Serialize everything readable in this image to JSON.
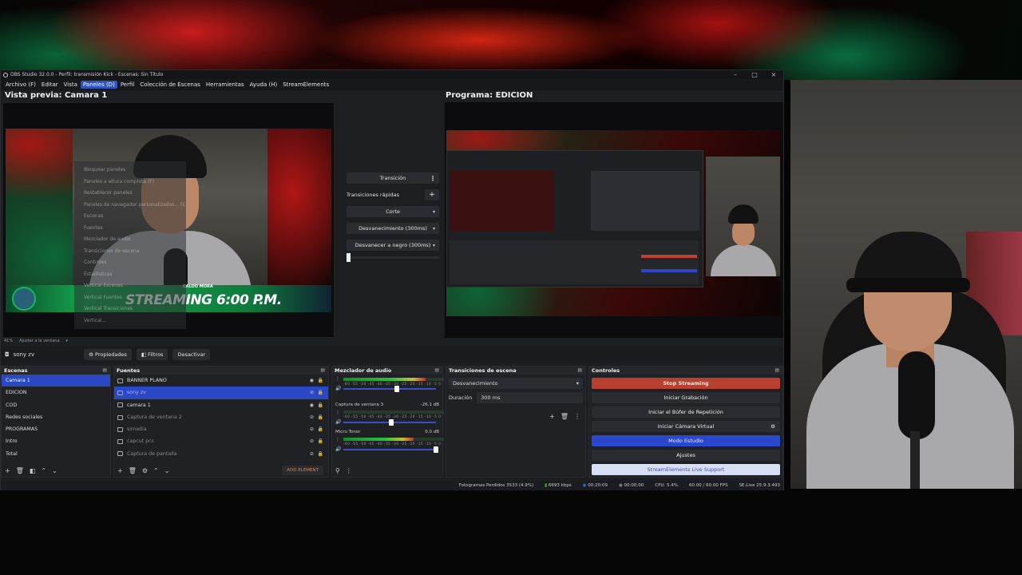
{
  "window": {
    "title": "OBS Studio 32.0.0 - Perfil: transmisión Kick - Escenas: Sin Título",
    "minimize": "–",
    "maximize": "□",
    "close": "×"
  },
  "menu": [
    "Archivo (F)",
    "Editar",
    "Vista",
    "Paneles (D)",
    "Perfil",
    "Colección de Escenas",
    "Herramientas",
    "Ayuda (H)",
    "StreamElements"
  ],
  "menu_active_index": 3,
  "dropdown": [
    "Bloquear paneles",
    "Paneles a altura completa (F)",
    "Restablecer paneles",
    "Paneles de navegador personalizados... (C)",
    "Escenas",
    "Fuentes",
    "Mezclador de audio",
    "Transiciones de escena",
    "Controles",
    "Estadísticas",
    "Vertical Escenas",
    "Vertical Fuentes",
    "Vertical Transiciones",
    "Vertical..."
  ],
  "preview": {
    "title": "Vista previa: Camara 1",
    "banner_name": "CALOO MORA",
    "banner_text": "STREAMING 6:00 P.M.",
    "zoom": "41%",
    "fit": "Ajustar a la ventana"
  },
  "program": {
    "title": "Programa: EDICION"
  },
  "transition_panel": {
    "transition_button": "Transición",
    "quick_label": "Transiciones rápidas",
    "options": [
      "Corte",
      "Desvanecimiento (300ms)",
      "Desvanecer a negro (300ms)"
    ]
  },
  "source_bar": {
    "source_name": "sony zv",
    "properties": "Propiedades",
    "filters": "Filtros",
    "deactivate": "Desactivar"
  },
  "scenes": {
    "title": "Escenas",
    "items": [
      "Camara 1",
      "EDICION",
      "COD",
      "Redes sociales",
      "PROGRAMAS",
      "Intro",
      "Total"
    ],
    "selected": 0
  },
  "sources": {
    "title": "Fuentes",
    "items": [
      "BANNER PLANO",
      "sony zv",
      "camara 1",
      "Captura de ventana 2",
      "simadia",
      "capcut pcc",
      "Captura de pantalla"
    ],
    "selected": 1,
    "add_element": "ADD ELEMENT"
  },
  "mixer": {
    "title": "Mezclador de audio",
    "scale": "-60 -55 -50 -45 -40 -35 -30 -25 -20 -15 -10 -5 0",
    "tracks": [
      {
        "name": "",
        "db": "",
        "level": 0.82,
        "volume": 0.58
      },
      {
        "name": "Captura de ventana 3",
        "db": "-26.1 dB",
        "level": 0.0,
        "volume": 0.52
      },
      {
        "name": "Micro Tonor",
        "db": "0.0 dB",
        "level": 0.7,
        "volume": 1.0
      }
    ]
  },
  "scene_transitions": {
    "title": "Transiciones de escena",
    "selected": "Desvanecimiento",
    "duration_label": "Duración",
    "duration_value": "300 ms"
  },
  "controls": {
    "title": "Controles",
    "buttons": [
      "Stop Streaming",
      "Iniciar Grabación",
      "Iniciar el Búfer de Repetición",
      "Iniciar Cámara Virtual",
      "Modo Estudio",
      "Ajustes",
      "StreamElements Live Support"
    ]
  },
  "status": {
    "dropped": "Fotogramas Perdidos 3533 (4.9%)",
    "bitrate": "6693 kbps",
    "stream_time": "00:20:09",
    "rec_time": "00:00:00",
    "cpu": "CPU: 5.4%",
    "fps": "60.00 / 60.00 FPS",
    "version": "SE.Live 25.9.3.493"
  },
  "colors": {
    "accent_blue": "#2a47c4",
    "stop_red": "#b8402f",
    "panel_bg": "#202125"
  }
}
